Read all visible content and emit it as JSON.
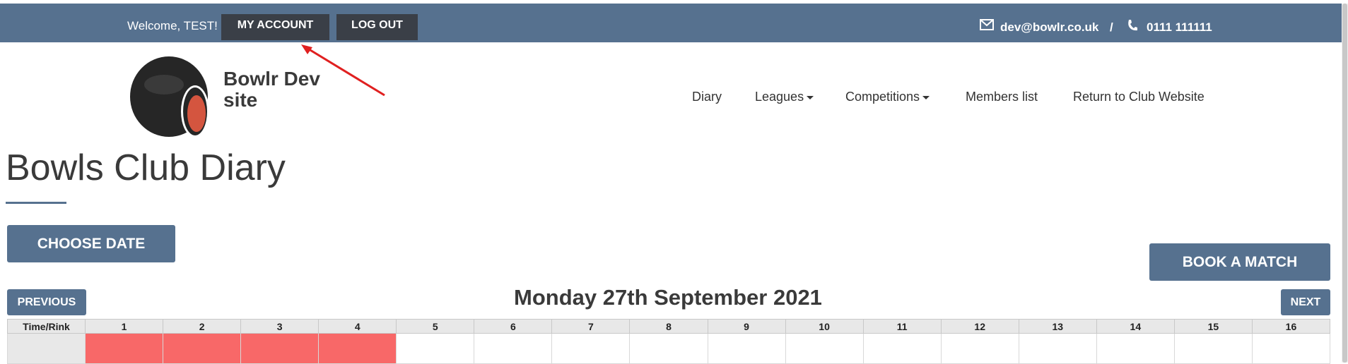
{
  "topbar": {
    "welcome": "Welcome, TEST!",
    "my_account": "MY ACCOUNT",
    "log_out": "LOG OUT",
    "email": "dev@bowlr.co.uk",
    "separator": "/",
    "phone": "0111 111111"
  },
  "site": {
    "name": "Bowlr Dev site"
  },
  "nav": {
    "diary": "Diary",
    "leagues": "Leagues",
    "competitions": "Competitions",
    "members": "Members list",
    "return": "Return to Club Website"
  },
  "page": {
    "title": "Bowls Club Diary"
  },
  "buttons": {
    "choose_date": "CHOOSE DATE",
    "book_match": "BOOK A MATCH",
    "previous": "PREVIOUS",
    "next": "NEXT"
  },
  "diary": {
    "date": "Monday 27th September 2021",
    "columns": [
      "Time/Rink",
      "1",
      "2",
      "3",
      "4",
      "5",
      "6",
      "7",
      "8",
      "9",
      "10",
      "11",
      "12",
      "13",
      "14",
      "15",
      "16"
    ],
    "booked_rinks": [
      "1",
      "2",
      "3",
      "4"
    ]
  },
  "colors": {
    "header_blue": "#56718f",
    "dark_button": "#3a3f47",
    "booked_red": "#f86868",
    "annotation_red": "#e02020"
  },
  "icons": {
    "email": "envelope-icon",
    "phone": "phone-icon",
    "logo": "bowling-ball-logo"
  }
}
